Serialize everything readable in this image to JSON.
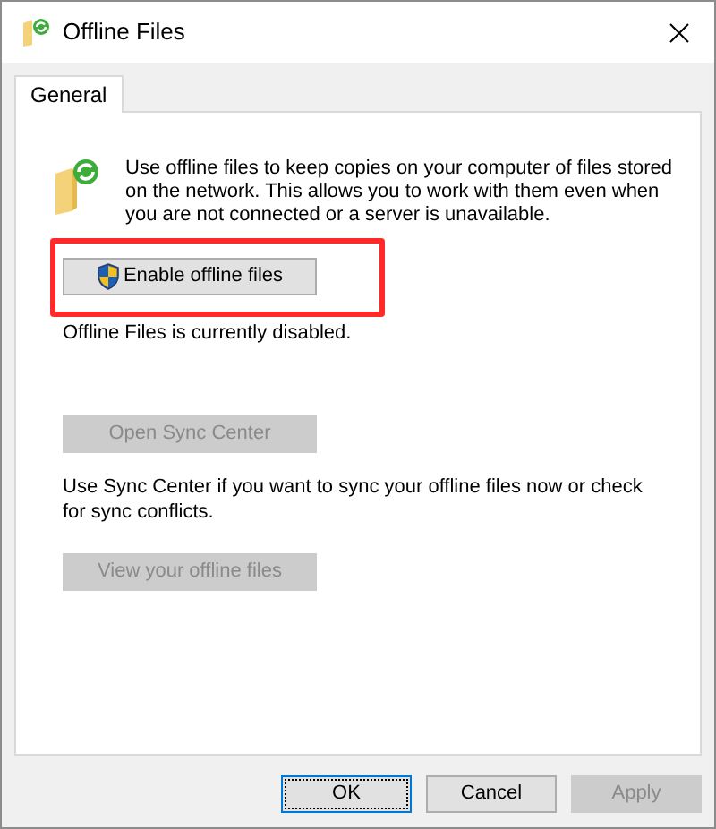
{
  "window": {
    "title": "Offline Files"
  },
  "tabs": [
    {
      "label": "General",
      "selected": true
    }
  ],
  "description": "Use offline files to keep copies on your computer of files stored on the network.  This allows you to work with them even when you are not connected or a server is unavailable.",
  "enable_button": {
    "label": "Enable offline files",
    "disabled": false,
    "highlighted": true
  },
  "status": "Offline Files is currently disabled.",
  "sync_button": {
    "label": "Open Sync Center",
    "disabled": true
  },
  "sync_note": "Use Sync Center if you want to sync your offline files now or check for sync conflicts.",
  "view_button": {
    "label": "View your offline files",
    "disabled": true
  },
  "footer_buttons": [
    {
      "label": "OK",
      "disabled": false,
      "focused": true
    },
    {
      "label": "Cancel",
      "disabled": false,
      "focused": false
    },
    {
      "label": "Apply",
      "disabled": true,
      "focused": false
    }
  ]
}
